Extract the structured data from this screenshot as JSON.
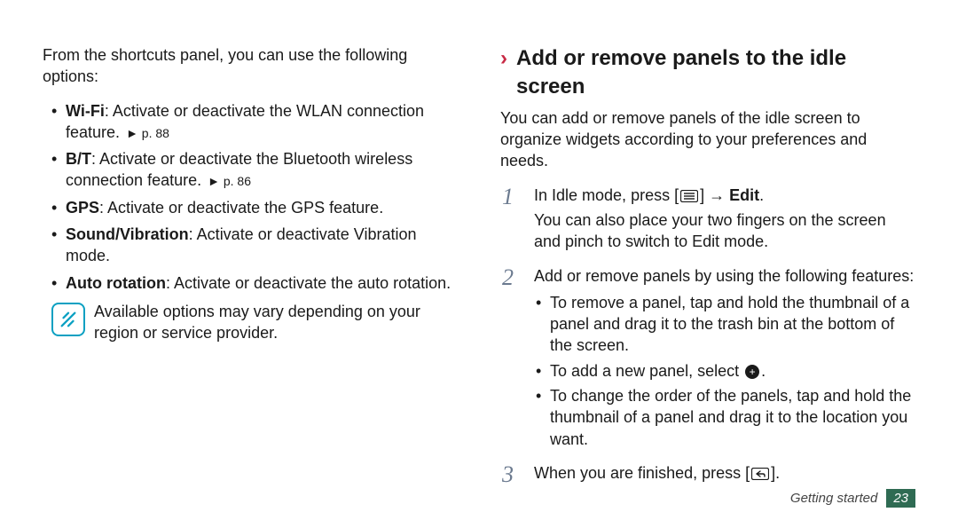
{
  "left": {
    "intro": "From the shortcuts panel, you can use the following options:",
    "items": [
      {
        "label": "Wi-Fi",
        "desc": ": Activate or deactivate the WLAN connection feature.",
        "ref": "► p. 88"
      },
      {
        "label": "B/T",
        "desc": ": Activate or deactivate the Bluetooth wireless connection feature.",
        "ref": "► p. 86"
      },
      {
        "label": "GPS",
        "desc": ": Activate or deactivate the GPS feature.",
        "ref": ""
      },
      {
        "label": "Sound/Vibration",
        "desc": ": Activate or deactivate Vibration mode.",
        "ref": ""
      },
      {
        "label": "Auto rotation",
        "desc": ": Activate or deactivate the auto rotation.",
        "ref": ""
      }
    ],
    "note": "Available options may vary depending on your region or service provider."
  },
  "right": {
    "heading": "Add or remove panels to the idle screen",
    "intro": "You can add or remove panels of the idle screen to organize widgets according to your preferences and needs.",
    "step1_pre": "In Idle mode, press [",
    "step1_post": "] → ",
    "step1_bold": "Edit",
    "step1_period": ".",
    "step1_extra": "You can also place your two fingers on the screen and pinch to switch to Edit mode.",
    "step2_intro": "Add or remove panels by using the following features:",
    "step2_sub": [
      "To remove a panel, tap and hold the thumbnail of a panel and drag it to the trash bin at the bottom of the screen.",
      "To add a new panel, select ",
      "To change the order of the panels, tap and hold the thumbnail of a panel and drag it to the location you want."
    ],
    "step2_sub2_suffix": ".",
    "step3_pre": "When you are finished, press [",
    "step3_post": "]."
  },
  "footer": {
    "section": "Getting started",
    "page": "23"
  }
}
